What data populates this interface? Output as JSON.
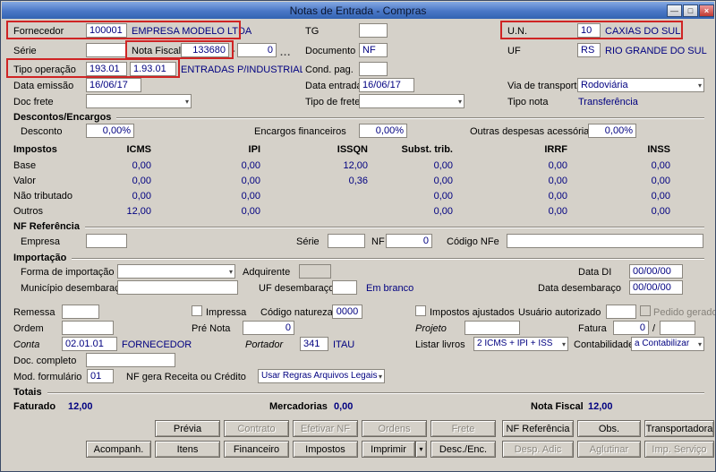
{
  "window": {
    "title": "Notas de Entrada - Compras"
  },
  "icons": {
    "minimize": "—",
    "maximize": "□",
    "close": "×",
    "dropdown": "▾"
  },
  "colors": {
    "value_text": "#000080",
    "highlight_box": "#cf2424"
  },
  "header": {
    "fornecedor": {
      "label": "Fornecedor",
      "code": "100001",
      "name": "EMPRESA MODELO LTDA"
    },
    "tg": {
      "label": "TG",
      "value": ""
    },
    "un": {
      "label": "U.N.",
      "code": "10",
      "name": "CAXIAS DO SUL"
    },
    "serie": {
      "label": "Série",
      "value": ""
    },
    "nota_fiscal": {
      "label": "Nota Fiscal",
      "number": "133680",
      "dash": "-",
      "sub": "0",
      "browse": "..."
    },
    "documento": {
      "label": "Documento",
      "value": "NF"
    },
    "uf": {
      "label": "UF",
      "code": "RS",
      "name": "RIO GRANDE DO SUL"
    },
    "tipo_operacao": {
      "label": "Tipo operação",
      "code": "193.01",
      "cfop": "1.93.01",
      "desc": "ENTRADAS P/INDUSTRIALIZACAO P/"
    },
    "cond_pag": {
      "label": "Cond. pag.",
      "value": ""
    },
    "data_emissao": {
      "label": "Data emissão",
      "value": "16/06/17"
    },
    "data_entrada": {
      "label": "Data entrada",
      "value": "16/06/17"
    },
    "via_transporte": {
      "label": "Via de transporte",
      "value": "Rodoviária"
    },
    "doc_frete": {
      "label": "Doc frete",
      "value": ""
    },
    "tipo_frete": {
      "label": "Tipo de frete",
      "value": ""
    },
    "tipo_nota": {
      "label": "Tipo nota",
      "value": "Transferência"
    }
  },
  "descontos": {
    "title": "Descontos/Encargos",
    "desconto": {
      "label": "Desconto",
      "value": "0,00%"
    },
    "encargos": {
      "label": "Encargos financeiros",
      "value": "0,00%"
    },
    "outras": {
      "label": "Outras despesas acessórias",
      "value": "0,00%"
    }
  },
  "impostos": {
    "title": "Impostos",
    "columns": [
      "ICMS",
      "IPI",
      "ISSQN",
      "Subst. trib.",
      "IRRF",
      "INSS"
    ],
    "rows": [
      {
        "label": "Base",
        "values": [
          "0,00",
          "0,00",
          "12,00",
          "0,00",
          "0,00",
          "0,00"
        ]
      },
      {
        "label": "Valor",
        "values": [
          "0,00",
          "0,00",
          "0,36",
          "0,00",
          "0,00",
          "0,00"
        ]
      },
      {
        "label": "Não tributado",
        "values": [
          "0,00",
          "0,00",
          "",
          "0,00",
          "0,00",
          "0,00"
        ]
      },
      {
        "label": "Outros",
        "values": [
          "12,00",
          "0,00",
          "",
          "0,00",
          "0,00",
          "0,00"
        ]
      }
    ]
  },
  "nf_ref": {
    "title": "NF Referência",
    "empresa": {
      "label": "Empresa",
      "value": ""
    },
    "serie": {
      "label": "Série",
      "value": ""
    },
    "nf": {
      "label": "NF",
      "value": "0"
    },
    "codigo_nfe": {
      "label": "Código NFe",
      "value": ""
    }
  },
  "importacao": {
    "title": "Importação",
    "forma": {
      "label": "Forma de importação",
      "value": ""
    },
    "adquirente": {
      "label": "Adquirente",
      "value": ""
    },
    "data_di": {
      "label": "Data DI",
      "value": "00/00/00"
    },
    "municipio": {
      "label": "Município desembaraço",
      "value": ""
    },
    "uf_desembaraco": {
      "label": "UF desembaraço",
      "value": "",
      "status": "Em branco"
    },
    "data_desembaraco": {
      "label": "Data desembaraço",
      "value": "00/00/00"
    }
  },
  "detalhes": {
    "remessa": {
      "label": "Remessa",
      "value": ""
    },
    "impressa": {
      "label": "Impressa",
      "checked": false
    },
    "codigo_natureza": {
      "label": "Código natureza",
      "value": "0000"
    },
    "impostos_ajustados": {
      "label": "Impostos ajustados",
      "checked": false
    },
    "usuario_autorizado": {
      "label": "Usuário autorizado",
      "value": ""
    },
    "pedido_gerado": {
      "label": "Pedido gerado",
      "checked": false,
      "enabled": false
    },
    "ordem": {
      "label": "Ordem",
      "value": ""
    },
    "pre_nota": {
      "label": "Pré Nota",
      "value": "0"
    },
    "projeto": {
      "label": "Projeto",
      "value": ""
    },
    "fatura": {
      "label": "Fatura",
      "value": "0",
      "separator": "/",
      "value2": ""
    },
    "conta": {
      "label": "Conta",
      "code": "02.01.01",
      "name": "FORNECEDOR"
    },
    "portador": {
      "label": "Portador",
      "code": "341",
      "name": "ITAU"
    },
    "listar_livros": {
      "label": "Listar livros",
      "value": "2 ICMS + IPI + ISS"
    },
    "contabilidade": {
      "label": "Contabilidade",
      "value": "a Contabilizar"
    },
    "doc_completo": {
      "label": "Doc. completo",
      "value": ""
    },
    "mod_formulario": {
      "label": "Mod. formulário",
      "value": "01"
    },
    "nf_gera": {
      "label": "NF gera Receita ou Crédito",
      "value": "Usar Regras Arquivos Legais"
    }
  },
  "totais": {
    "title": "Totais",
    "faturado": {
      "label": "Faturado",
      "value": "12,00"
    },
    "mercadorias": {
      "label": "Mercadorias",
      "value": "0,00"
    },
    "nota_fiscal": {
      "label": "Nota Fiscal",
      "value": "12,00"
    }
  },
  "buttons": {
    "row1": [
      {
        "label": "Prévia",
        "enabled": true
      },
      {
        "label": "Contrato",
        "enabled": false
      },
      {
        "label": "Efetivar NF",
        "enabled": false
      },
      {
        "label": "Ordens",
        "enabled": false
      },
      {
        "label": "Frete",
        "enabled": false
      },
      {
        "label": "NF Referência",
        "enabled": true
      },
      {
        "label": "Obs.",
        "enabled": true
      },
      {
        "label": "Transportadora",
        "enabled": true
      }
    ],
    "row2": [
      {
        "label": "Acompanh.",
        "enabled": true
      },
      {
        "label": "Itens",
        "enabled": true
      },
      {
        "label": "Financeiro",
        "enabled": true
      },
      {
        "label": "Impostos",
        "enabled": true
      },
      {
        "label": "Imprimir",
        "enabled": true,
        "split": true
      },
      {
        "label": "Desc./Enc.",
        "enabled": true
      },
      {
        "label": "Desp. Adic",
        "enabled": false
      },
      {
        "label": "Aglutinar",
        "enabled": false
      },
      {
        "label": "Imp. Serviço",
        "enabled": false
      }
    ]
  }
}
